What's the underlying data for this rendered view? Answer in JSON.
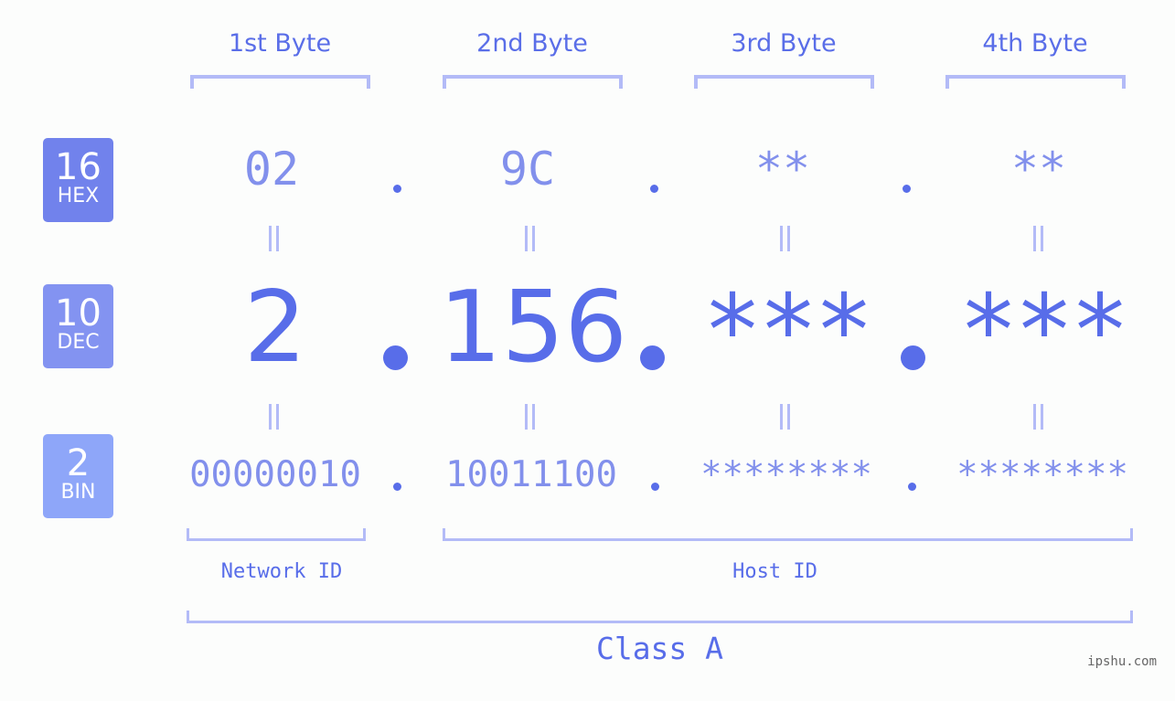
{
  "bytes": {
    "labels": [
      "1st Byte",
      "2nd Byte",
      "3rd Byte",
      "4th Byte"
    ]
  },
  "badges": {
    "hex": {
      "number": "16",
      "label": "HEX",
      "color": "#7182ec"
    },
    "dec": {
      "number": "10",
      "label": "DEC",
      "color": "#8393f1"
    },
    "bin": {
      "number": "2",
      "label": "BIN",
      "color": "#8ea6f9"
    }
  },
  "hex": [
    "02",
    "9C",
    "**",
    "**"
  ],
  "dec": [
    "2",
    "156",
    "***",
    "***"
  ],
  "bin": [
    "00000010",
    "10011100",
    "********",
    "********"
  ],
  "ids": {
    "network": "Network ID",
    "host": "Host ID"
  },
  "class_label": "Class A",
  "watermark": "ipshu.com",
  "colors": {
    "primary": "#586de9",
    "light": "#8290ec",
    "bracket": "#b3bbf7",
    "background": "#fcfdfc"
  }
}
